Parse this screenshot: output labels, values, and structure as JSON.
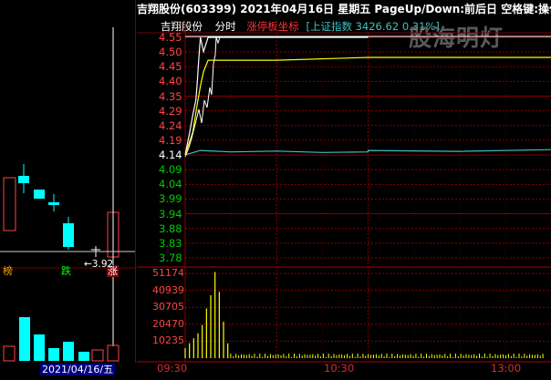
{
  "header": {
    "title": "吉翔股份(603399)  2021年04月16日  星期五  PageUp/Down:前后日  空格键:操作"
  },
  "subheader": {
    "stock_name": "吉翔股份",
    "mode": "分时",
    "limit_label": "涨停板坐标",
    "index_label": "[上证指数  3426.62 0.31%]"
  },
  "watermark": "股海明灯",
  "price_axis": [
    "4.55",
    "4.50",
    "4.45",
    "4.40",
    "4.35",
    "4.29",
    "4.24",
    "4.19",
    "4.14",
    "4.09",
    "4.04",
    "3.99",
    "3.94",
    "3.88",
    "3.83",
    "3.78"
  ],
  "volume_axis": [
    "51174",
    "40939",
    "30705",
    "20470",
    "10235"
  ],
  "time_axis": [
    "09:30",
    "10:30",
    "13:00"
  ],
  "left_panel": {
    "badges": [
      "榜",
      "跌",
      "涨"
    ],
    "low_marker": "←3.92",
    "date": "2021/04/16/五"
  },
  "colors": {
    "price_line": "#ffffff",
    "avg_line": "#ffff00",
    "index_line": "#40c0c0",
    "axis_red": "#ff4444",
    "volume_bar": "#ffff00",
    "grid": "#8b0000"
  },
  "chart_data": {
    "type": "line",
    "series": [
      {
        "name": "price",
        "x": [
          "09:30",
          "09:33",
          "09:35",
          "09:37",
          "09:38",
          "09:39",
          "09:40",
          "09:42",
          "09:45",
          "10:00",
          "11:30"
        ],
        "values": [
          4.14,
          4.22,
          4.28,
          4.33,
          4.4,
          4.48,
          4.55,
          4.5,
          4.55,
          4.55,
          4.55
        ]
      },
      {
        "name": "avg",
        "x": [
          "09:30",
          "09:35",
          "09:38",
          "09:40",
          "09:42",
          "09:45",
          "10:30",
          "13:00",
          "15:00"
        ],
        "values": [
          4.14,
          4.22,
          4.32,
          4.38,
          4.43,
          4.47,
          4.47,
          4.48,
          4.48
        ]
      },
      {
        "name": "index",
        "x": [
          "09:30",
          "09:40",
          "10:00",
          "10:30",
          "11:00",
          "11:30",
          "13:00",
          "14:00",
          "15:00"
        ],
        "values": [
          4.14,
          4.155,
          4.15,
          4.153,
          4.148,
          4.15,
          4.155,
          4.152,
          4.158
        ]
      }
    ],
    "volume": {
      "x": [
        "09:30",
        "09:31",
        "09:32",
        "09:33",
        "09:34",
        "09:35",
        "09:36",
        "09:37",
        "09:38",
        "09:39",
        "09:40"
      ],
      "values": [
        6000,
        9000,
        12000,
        15000,
        20000,
        30000,
        38000,
        52000,
        40000,
        22000,
        9000
      ]
    },
    "ylim": [
      3.78,
      4.55
    ],
    "volume_ylim": [
      0,
      51174
    ]
  }
}
